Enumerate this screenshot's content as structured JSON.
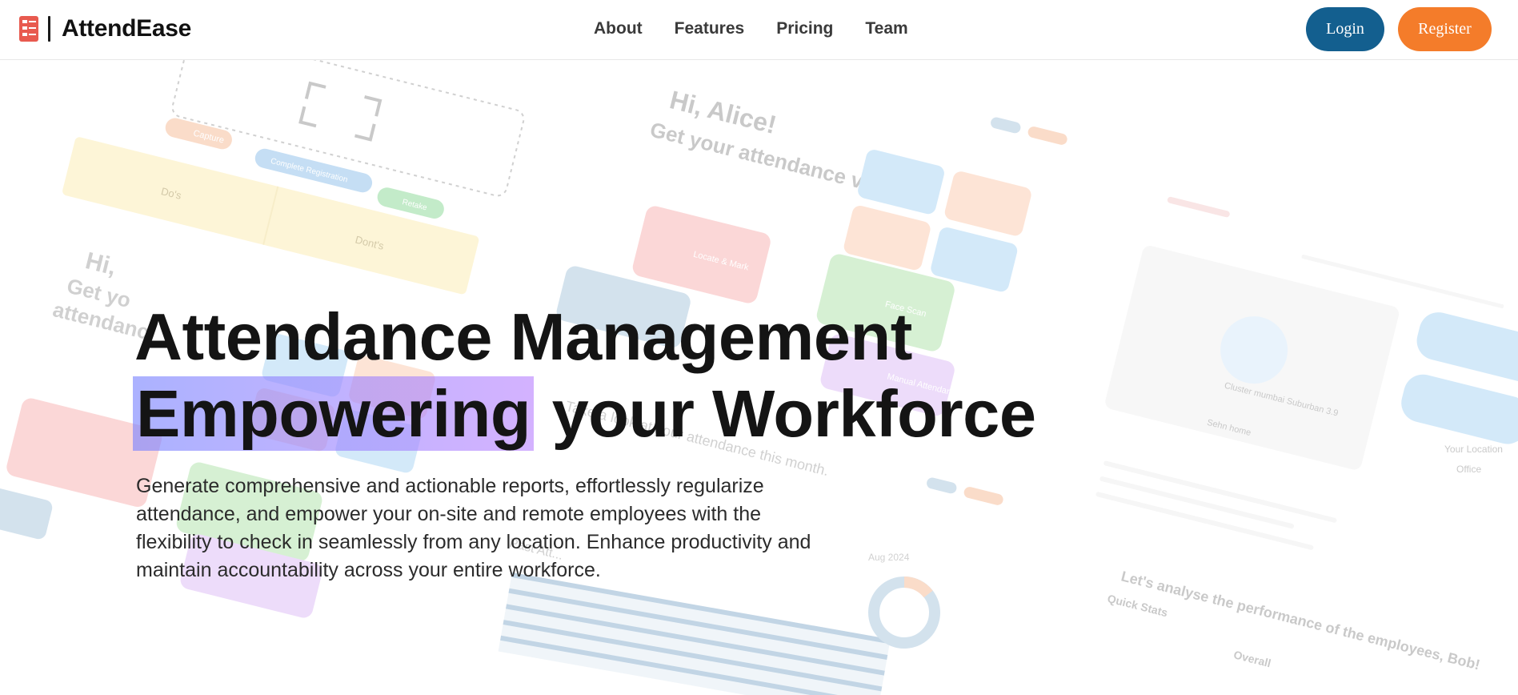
{
  "brand": {
    "name": "AttendEase",
    "logo_icon": "attendance-sheet-icon"
  },
  "nav": {
    "links": [
      {
        "label": "About"
      },
      {
        "label": "Features"
      },
      {
        "label": "Pricing"
      },
      {
        "label": "Team"
      }
    ],
    "login_label": "Login",
    "register_label": "Register"
  },
  "hero": {
    "title_line1": "Attendance Management",
    "title_highlight": "Empowering",
    "title_rest": " your Workforce",
    "description": "Generate comprehensive and actionable reports, effortlessly regularize attendance, and empower your on-site and remote employees with the flexibility to check in seamlessly from any location. Enhance productivity and maintain accountability across your entire workforce."
  },
  "background_collage": {
    "texts": [
      "Capture",
      "Complete Registration",
      "Retake",
      "Do's",
      "Dont's",
      "Hi, Alice!",
      "Get your attendance verified.",
      "Locate & Mark",
      "Face Scan",
      "Manual Attendance",
      "Take a look at your attendance this month.",
      "Past Att...",
      "Aug 2024",
      "Let's analyse the performance of the employees, Bob!",
      "Quick Stats",
      "Overall",
      "Your Location",
      "Office",
      "Cluster mumbai Suburban 3.9",
      "Sehn home"
    ],
    "colors": {
      "yellow": "#fbe9a8",
      "blue": "#9fd0f2",
      "peach": "#fbc5a6",
      "green": "#a5e0a0",
      "pink": "#f7a7a7",
      "lavender": "#d9b2f4",
      "slate": "#9fbfd8",
      "orange": "#f6b28a"
    }
  }
}
